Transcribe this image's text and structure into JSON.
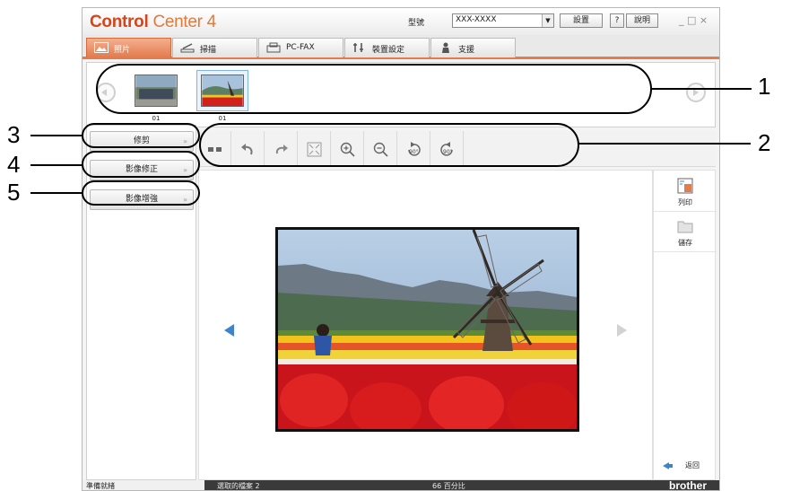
{
  "app": {
    "logo_bold": "Control",
    "logo_rest": "Center 4",
    "model_label": "型號",
    "model_value": "XXX-XXXX",
    "settings_button": "設置",
    "help_q": "?",
    "help_button": "說明",
    "window_controls": "_ □ ×"
  },
  "tabs": [
    {
      "label": "照片",
      "icon": "photo-icon"
    },
    {
      "label": "掃描",
      "icon": "scanner-icon"
    },
    {
      "label": "PC-FAX",
      "icon": "fax-icon"
    },
    {
      "label": "裝置設定",
      "icon": "device-settings-icon"
    },
    {
      "label": "支援",
      "icon": "support-icon"
    }
  ],
  "thumbnails": [
    {
      "caption": "01",
      "selected": false
    },
    {
      "caption": "01",
      "selected": true
    }
  ],
  "left_panel": {
    "buttons": [
      "修剪",
      "影像修正",
      "影像增強"
    ]
  },
  "toolbar": {
    "tools": [
      "thumbnail-view-icon",
      "undo-icon",
      "redo-icon",
      "fit-to-window-icon",
      "zoom-in-icon",
      "zoom-out-icon",
      "rotate-left-90-icon",
      "rotate-right-90-icon"
    ],
    "rotate_label": "90°"
  },
  "right_panel": {
    "print_label": "列印",
    "save_label": "儲存",
    "back_label": "返回"
  },
  "status": {
    "ready": "準備就緒",
    "selected_files": "選取的檔案 2",
    "zoom": "66 百分比",
    "brand": "brother"
  },
  "callouts": [
    "1",
    "2",
    "3",
    "4",
    "5"
  ],
  "colors": {
    "accent": "#e27b4e",
    "logo": "#d5451b",
    "nav_arrow": "#3f84c8"
  }
}
